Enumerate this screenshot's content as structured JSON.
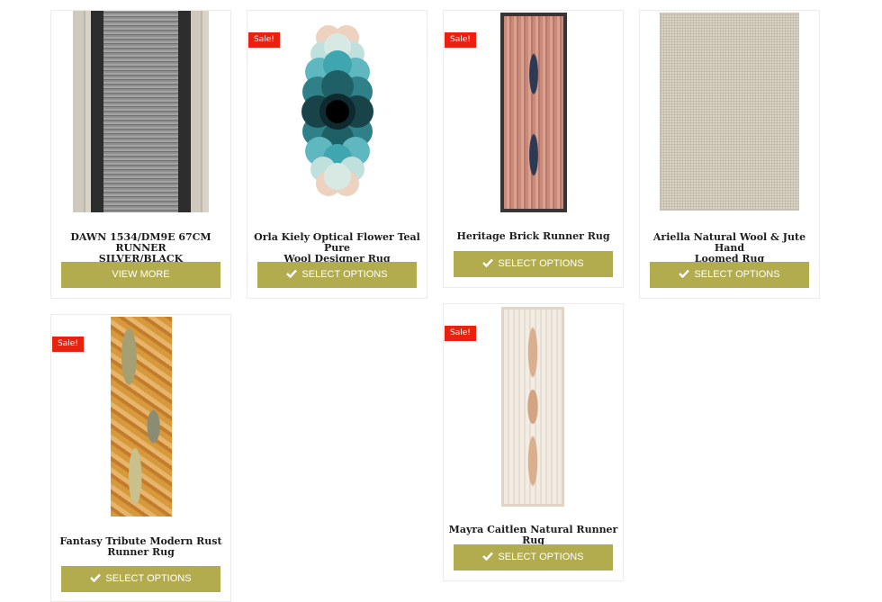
{
  "sale_label": "Sale!",
  "colors": {
    "button": "#b3ac4e",
    "sale_badge": "#e8220f"
  },
  "products": [
    {
      "title_line1": "DAWN 1534/DM9E 67CM RUNNER",
      "title_line2": "SILVER/BLACK",
      "button": "VIEW MORE",
      "icon": "",
      "on_sale": false
    },
    {
      "title_line1": "Orla Kiely Optical Flower Teal Pure",
      "title_line2": "Wool Designer Rug",
      "button": "SELECT OPTIONS",
      "icon": "check-icon",
      "on_sale": true
    },
    {
      "title_line1": "Heritage Brick Runner Rug",
      "title_line2": "",
      "button": "SELECT OPTIONS",
      "icon": "check-icon",
      "on_sale": true
    },
    {
      "title_line1": "Ariella Natural Wool & Jute Hand",
      "title_line2": "Loomed Rug",
      "button": "SELECT OPTIONS",
      "icon": "check-icon",
      "on_sale": false
    },
    {
      "title_line1": "Fantasy Tribute Modern Rust",
      "title_line2": "Runner Rug",
      "button": "SELECT OPTIONS",
      "icon": "check-icon",
      "on_sale": true
    },
    {
      "title_line1": "Mayra Caitlen Natural Runner Rug",
      "title_line2": "",
      "button": "SELECT OPTIONS",
      "icon": "check-icon",
      "on_sale": true
    }
  ]
}
